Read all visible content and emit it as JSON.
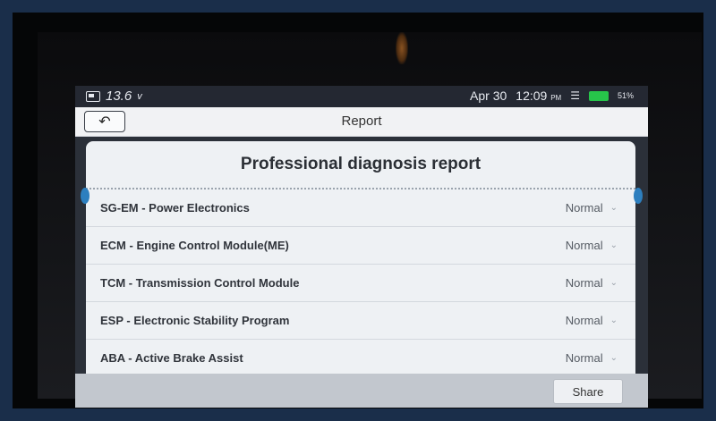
{
  "status_bar": {
    "voltage": "13.6",
    "voltage_unit": "v",
    "date": "Apr 30",
    "time": "12:09",
    "ampm": "PM",
    "battery_percent": "51%"
  },
  "header": {
    "back_icon": "back-arrow-icon",
    "title": "Report"
  },
  "report": {
    "title": "Professional diagnosis report",
    "rows": [
      {
        "label": "SG-EM - Power Electronics",
        "status": "Normal"
      },
      {
        "label": "ECM - Engine Control Module(ME)",
        "status": "Normal"
      },
      {
        "label": "TCM - Transmission Control Module",
        "status": "Normal"
      },
      {
        "label": "ESP - Electronic Stability Program",
        "status": "Normal"
      },
      {
        "label": "ABA - Active Brake Assist",
        "status": "Normal"
      }
    ]
  },
  "footer": {
    "share_label": "Share"
  },
  "colors": {
    "frame": "#1a2e4a",
    "battery": "#27c54a",
    "accent": "#2d7fbf"
  }
}
